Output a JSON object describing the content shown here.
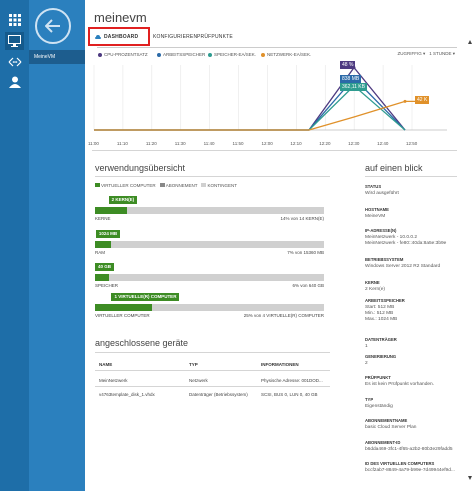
{
  "rail": {
    "icons": [
      "grid-icon",
      "monitor-icon",
      "network-icon",
      "user-icon"
    ]
  },
  "nav": {
    "selected_item": "MeineVM"
  },
  "header": {
    "title": "meinevm"
  },
  "tabs": [
    {
      "label": "DASHBOARD",
      "active": true
    },
    {
      "label": "KONFIGURIEREN",
      "active": false
    },
    {
      "label": "PRÜFPUNKTE",
      "active": false
    }
  ],
  "chart_legend": [
    {
      "label": "CPU-PROZENTSATZ",
      "color": "#4d3a80"
    },
    {
      "label": "ARBEITSSPEICHER",
      "color": "#2b6aa8"
    },
    {
      "label": "SPEICHER-EA/SEK.",
      "color": "#2f9c90"
    },
    {
      "label": "NETZWERK-EA/SEK.",
      "color": "#e0912a"
    }
  ],
  "chart_controls": {
    "scale": "ZUGRIFFIG",
    "range": "1 STUNDE"
  },
  "chart_data": {
    "type": "line",
    "x": [
      "11:00",
      "11:20",
      "11:40",
      "12:00",
      "12:10",
      "12:20",
      "12:30",
      "12:40",
      "12:50",
      "13:00"
    ],
    "xlabels": [
      "11:00",
      "11:20",
      "11:40",
      "12:00",
      "12:10",
      "12:20",
      "12:30",
      "12:40",
      "12:50",
      "13:00"
    ],
    "series": [
      {
        "name": "CPU-PROZENTSATZ",
        "color": "#4d3a80",
        "values": [
          0,
          0,
          0,
          0,
          0,
          0,
          0,
          0,
          48,
          0
        ],
        "label": "48 %"
      },
      {
        "name": "ARBEITSSPEICHER",
        "color": "#2b6aa8",
        "values": [
          0,
          0,
          0,
          0,
          0,
          0,
          0,
          0,
          40,
          0
        ],
        "label": "838 MB"
      },
      {
        "name": "SPEICHER-EA/SEK.",
        "color": "#2f9c90",
        "values": [
          0,
          0,
          0,
          0,
          0,
          0,
          0,
          0,
          34,
          0
        ],
        "label": "362,11 KB"
      },
      {
        "name": "NETZWERK-EA/SEK.",
        "color": "#e0912a",
        "values": [
          0,
          0,
          0,
          0,
          0,
          0,
          0,
          0,
          10,
          22
        ],
        "label": "42 K"
      }
    ],
    "tick_labels": [
      "11:00",
      "11:10",
      "11:20",
      "11:30",
      "11:40",
      "11:50",
      "12:00",
      "12:10",
      "12:20",
      "12:30",
      "12:40",
      "12:50"
    ]
  },
  "usage": {
    "title": "verwendungsübersicht",
    "legend": [
      {
        "label": "VIRTUELLER COMPUTER",
        "color": "#3d8c24"
      },
      {
        "label": "ABONNEMENT",
        "color": "#888888"
      },
      {
        "label": "KONTINGENT",
        "color": "#d0d0d0"
      }
    ],
    "rows": [
      {
        "tag": "2 KERN(E)",
        "label": "KERNE",
        "value": "14% von 14 KERN(E)",
        "fraction": 0.14
      },
      {
        "tag": "1024 MB",
        "label": "RAM",
        "value": "7% von 15360 MB",
        "fraction": 0.07
      },
      {
        "tag": "40 GB",
        "label": "SPEICHER",
        "value": "6% von 640 GB",
        "fraction": 0.06
      },
      {
        "tag": "1 VIRTUELLE(R) COMPUTER",
        "label": "VIRTUELLER COMPUTER",
        "value": "25% von 4 VIRTUELLE(R) COMPUTER",
        "fraction": 0.25
      }
    ]
  },
  "devices": {
    "title": "angeschlossene geräte",
    "headers": [
      "NAME",
      "TYP",
      "INFORMATIONEN"
    ],
    "rows": [
      [
        "MeinNetzwerk",
        "Netzwerk",
        "Physische Adresse: 001DOD..."
      ],
      [
        "v4763template_disk_1.vhdx",
        "Datenträger (Betriebssystem)",
        "SCSI, BUS 0, LUN 0, 40 GB"
      ]
    ]
  },
  "glance": {
    "title": "auf einen blick",
    "items": [
      {
        "k": "STATUS",
        "v": "Wird ausgeführt"
      },
      {
        "k": "HOSTNAME",
        "v": "MeineVM"
      },
      {
        "k": "IP-ADRESSE(N)",
        "v": "MeinNetzwerk - 10.0.0.2\nMeinNetzwerk - fe80::40da:8a5e:3b9e"
      },
      {
        "k": "BETRIEBSSYSTEM",
        "v": "Windows Server 2012 R2 Standard"
      },
      {
        "k": "KERNE",
        "v": "2 Kern(e)"
      },
      {
        "k": "ARBEITSSPEICHER",
        "v": "Start: 512 MB\nMin.: 512 MB\nMax.: 1024 MB"
      },
      {
        "k": "DATENTRÄGER",
        "v": "1"
      },
      {
        "k": "GENERIERUNG",
        "v": "2"
      },
      {
        "k": "PRÜFPUNKT",
        "v": "Es ist kein Prüfpunkt vorhanden."
      },
      {
        "k": "TYP",
        "v": "Eigenständig"
      },
      {
        "k": "ABONNEMENTNAME",
        "v": "basic Cloud Server Plan"
      },
      {
        "k": "ABONNEMENT-ID",
        "v": "b6dda469-3fc1-4f65-a2b2-80b3e29fadd5"
      },
      {
        "k": "ID DES VIRTUELLEN COMPUTERS",
        "v": "bccf2ab7-8849-4a79-b99e-7d49944ef9d..."
      }
    ]
  }
}
